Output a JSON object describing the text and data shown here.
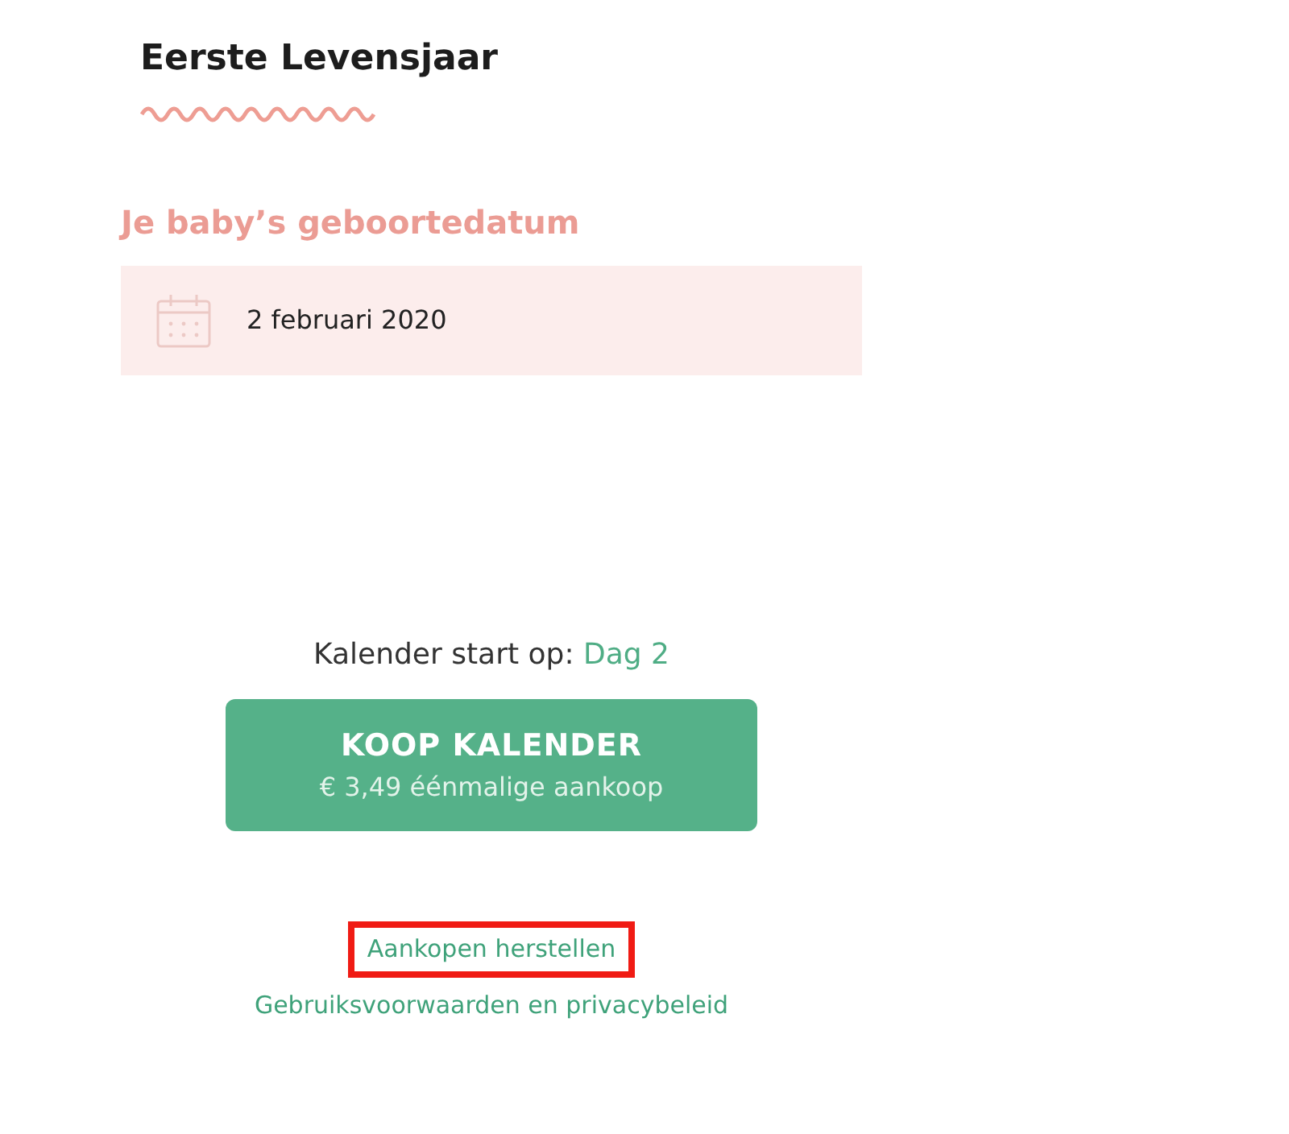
{
  "title": "Eerste Levensjaar",
  "birthdate": {
    "label": "Je baby’s geboortedatum",
    "value": "2 februari 2020"
  },
  "start": {
    "label": "Kalender start op:",
    "value": "Dag 2"
  },
  "buy_button": {
    "label": "KOOP KALENDER",
    "sublabel": "€ 3,49 éénmalige aankoop"
  },
  "links": [
    {
      "label": "Aankopen herstellen",
      "highlighted": true
    },
    {
      "label": "Gebruiksvoorwaarden en privacybeleid",
      "highlighted": false
    }
  ]
}
